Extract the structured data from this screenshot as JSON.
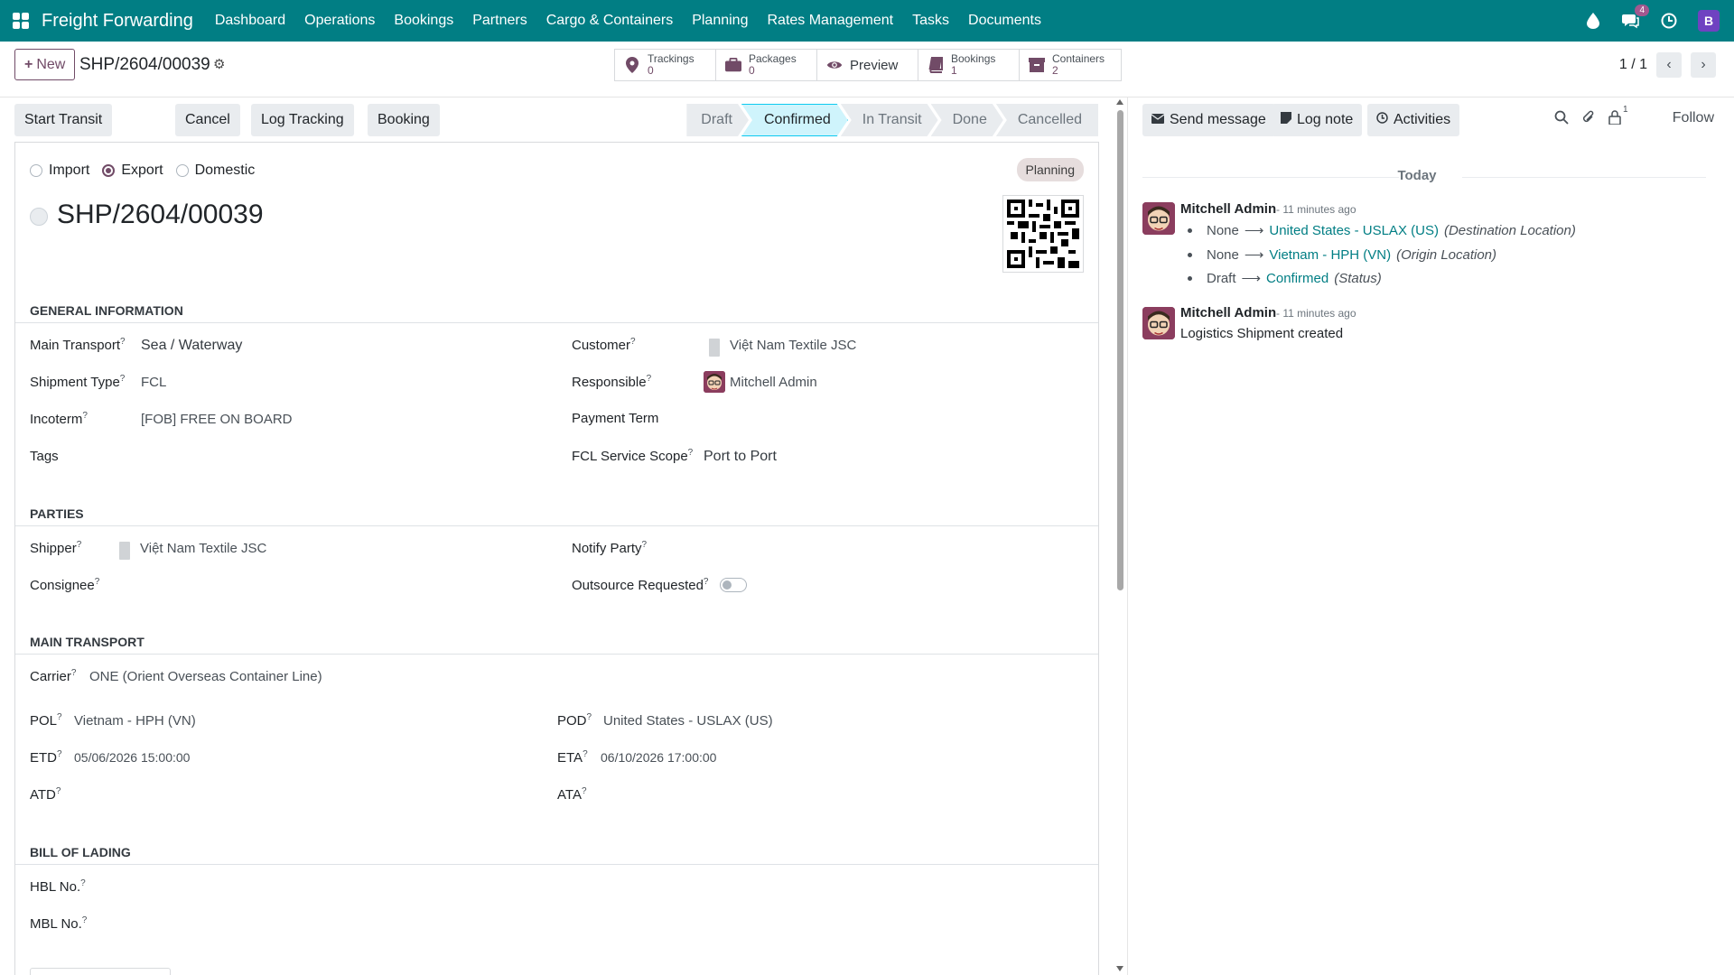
{
  "app": {
    "brand": "Freight Forwarding",
    "menu": [
      "Dashboard",
      "Operations",
      "Bookings",
      "Partners",
      "Cargo & Containers",
      "Planning",
      "Rates Management",
      "Tasks",
      "Documents"
    ],
    "messages_badge": "4",
    "user_initial": "B"
  },
  "control": {
    "new_label": "New",
    "record_name": "SHP/2604/00039",
    "smart_buttons": [
      {
        "label": "Trackings",
        "count": "0",
        "icon": "map-pin-icon"
      },
      {
        "label": "Packages",
        "count": "0",
        "icon": "briefcase-icon"
      },
      {
        "label": "Preview",
        "count": "",
        "icon": "eye-icon"
      },
      {
        "label": "Bookings",
        "count": "1",
        "icon": "book-icon"
      },
      {
        "label": "Containers",
        "count": "2",
        "icon": "archive-icon"
      }
    ],
    "pager": "1 / 1"
  },
  "actions": {
    "start_transit": "Start Transit",
    "cancel": "Cancel",
    "log_tracking": "Log Tracking",
    "booking": "Booking"
  },
  "stages": [
    "Draft",
    "Confirmed",
    "In Transit",
    "Done",
    "Cancelled"
  ],
  "active_stage": "Confirmed",
  "form": {
    "direction_options": [
      "Import",
      "Export",
      "Domestic"
    ],
    "direction_selected": "Export",
    "badge": "Planning",
    "title": "SHP/2604/00039",
    "sections": {
      "general": "GENERAL INFORMATION",
      "parties": "PARTIES",
      "main_transport": "MAIN TRANSPORT",
      "bill_of_lading": "BILL OF LADING"
    },
    "labels": {
      "main_transport": "Main Transport",
      "shipment_type": "Shipment Type",
      "incoterm": "Incoterm",
      "tags": "Tags",
      "customer": "Customer",
      "responsible": "Responsible",
      "payment_term": "Payment Term",
      "fcl_scope": "FCL Service Scope",
      "shipper": "Shipper",
      "consignee": "Consignee",
      "notify_party": "Notify Party",
      "outsource": "Outsource Requested",
      "carrier": "Carrier",
      "pol": "POL",
      "pod": "POD",
      "etd": "ETD",
      "eta": "ETA",
      "atd": "ATD",
      "ata": "ATA",
      "hbl": "HBL No.",
      "mbl": "MBL No."
    },
    "values": {
      "main_transport": "Sea / Waterway",
      "shipment_type": "FCL",
      "incoterm": "[FOB] FREE ON BOARD",
      "customer": "Việt Nam Textile JSC",
      "responsible": "Mitchell Admin",
      "fcl_scope": "Port to Port",
      "shipper": "Việt Nam Textile JSC",
      "carrier": "ONE (Orient Overseas Container Line)",
      "pol": "Vietnam - HPH (VN)",
      "pod": "United States - USLAX (US)",
      "etd": "05/06/2026 15:00:00",
      "eta": "06/10/2026 17:00:00"
    }
  },
  "chatter": {
    "send_message": "Send message",
    "log_note": "Log note",
    "activities": "Activities",
    "followers_count": "1",
    "follow": "Follow",
    "today": "Today",
    "messages": [
      {
        "author": "Mitchell Admin",
        "time": "- 11 minutes ago",
        "tracking": [
          {
            "old": "None",
            "new": "United States - USLAX (US)",
            "field": "(Destination Location)"
          },
          {
            "old": "None",
            "new": "Vietnam - HPH (VN)",
            "field": "(Origin Location)"
          },
          {
            "old": "Draft",
            "new": "Confirmed",
            "field": "(Status)"
          }
        ]
      },
      {
        "author": "Mitchell Admin",
        "time": "- 11 minutes ago",
        "body": "Logistics Shipment created"
      }
    ]
  }
}
